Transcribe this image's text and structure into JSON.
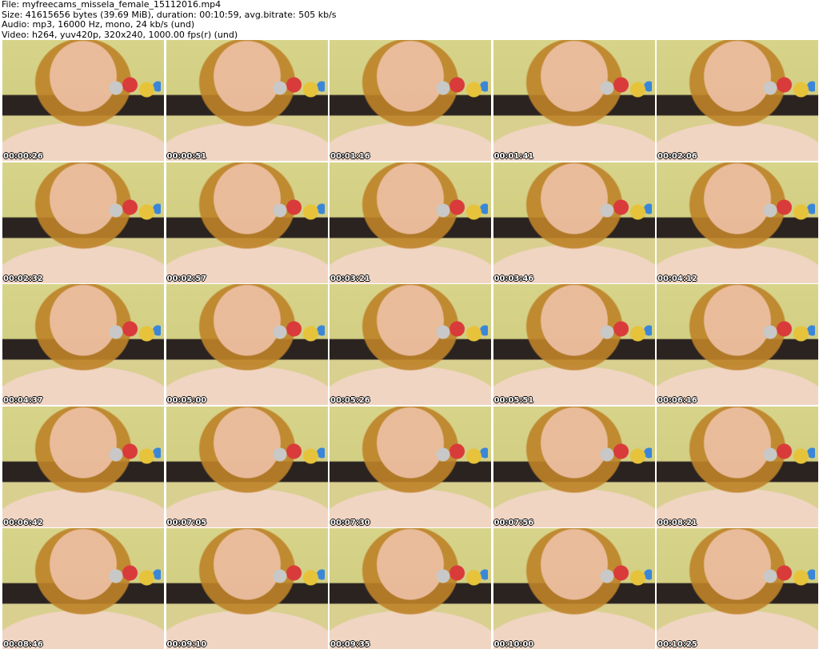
{
  "info": {
    "file": "File: myfreecams_missela_female_15112016.mp4",
    "size": "Size: 41615656 bytes (39.69 MiB), duration: 00:10:59, avg.bitrate: 505 kb/s",
    "audio": "Audio: mp3, 16000 Hz, mono, 24 kb/s (und)",
    "video": "Video: h264, yuv420p, 320x240, 1000.00 fps(r) (und)"
  },
  "thumbnails": [
    {
      "timestamp": "00:00:26"
    },
    {
      "timestamp": "00:00:51"
    },
    {
      "timestamp": "00:01:16"
    },
    {
      "timestamp": "00:01:41"
    },
    {
      "timestamp": "00:02:06"
    },
    {
      "timestamp": "00:02:32"
    },
    {
      "timestamp": "00:02:57"
    },
    {
      "timestamp": "00:03:21"
    },
    {
      "timestamp": "00:03:46"
    },
    {
      "timestamp": "00:04:12"
    },
    {
      "timestamp": "00:04:37"
    },
    {
      "timestamp": "00:05:00"
    },
    {
      "timestamp": "00:05:26"
    },
    {
      "timestamp": "00:05:51"
    },
    {
      "timestamp": "00:06:16"
    },
    {
      "timestamp": "00:06:42"
    },
    {
      "timestamp": "00:07:05"
    },
    {
      "timestamp": "00:07:30"
    },
    {
      "timestamp": "00:07:56"
    },
    {
      "timestamp": "00:08:21"
    },
    {
      "timestamp": "00:08:46"
    },
    {
      "timestamp": "00:09:10"
    },
    {
      "timestamp": "00:09:35"
    },
    {
      "timestamp": "00:10:00"
    },
    {
      "timestamp": "00:10:25"
    }
  ]
}
